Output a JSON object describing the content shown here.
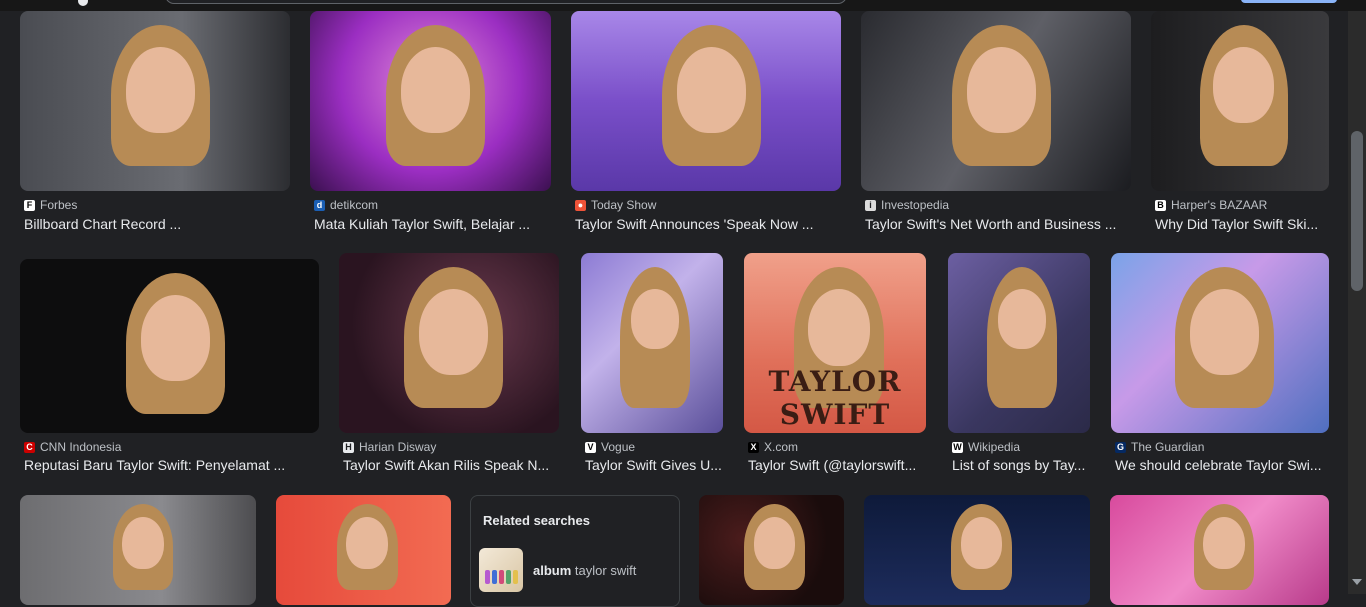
{
  "row1": [
    {
      "source": "Forbes",
      "favicon": "F",
      "favcolor": "#ffffff",
      "favtext": "#000000",
      "title": "Billboard Chart Record ...",
      "bg": "linear-gradient(90deg,#4a4c52,#6a6c72 60%,#2c2d31)"
    },
    {
      "source": "detikcom",
      "favicon": "d",
      "favcolor": "#1a5eb3",
      "favtext": "#ffffff",
      "title": "Mata Kuliah Taylor Swift, Belajar ...",
      "bg": "radial-gradient(circle at 50% 40%,#e28ad8,#9b2ec2 55%,#3b1050)"
    },
    {
      "source": "Today Show",
      "favicon": "●",
      "favcolor": "#ef5338",
      "favtext": "#ffffff",
      "title": "Taylor Swift Announces 'Speak Now ...",
      "bg": "linear-gradient(180deg,#a887e8,#7a4fc9 50%,#5a38a8)"
    },
    {
      "source": "Investopedia",
      "favicon": "i",
      "favcolor": "#dcdcdc",
      "favtext": "#202124",
      "title": "Taylor Swift's Net Worth and Business ...",
      "bg": "linear-gradient(120deg,#2a2b30,#5e5f66 50%,#1b1c20)"
    },
    {
      "source": "Harper's BAZAAR",
      "favicon": "B",
      "favcolor": "#ffffff",
      "favtext": "#000000",
      "title": "Why Did Taylor Swift Ski...",
      "bg": "linear-gradient(90deg,#1d1d1f,#3a3a3d)"
    }
  ],
  "row2": [
    {
      "source": "CNN Indonesia",
      "favicon": "C",
      "favcolor": "#cc0000",
      "favtext": "#ffffff",
      "title": "Reputasi Baru Taylor Swift: Penyelamat ...",
      "bg": "#0d0d0e"
    },
    {
      "source": "Harian Disway",
      "favicon": "H",
      "favcolor": "#e8eaed",
      "favtext": "#202124",
      "title": "Taylor Swift Akan Rilis Speak N...",
      "bg": "radial-gradient(circle at 60% 40%,#6b3a4e,#2a1420 70%)"
    },
    {
      "source": "Vogue",
      "favicon": "V",
      "favcolor": "#ffffff",
      "favtext": "#000000",
      "title": "Taylor Swift Gives U...",
      "bg": "linear-gradient(135deg,#8c7bd4,#c2b2ea 40%,#5a4f9a)"
    },
    {
      "source": "X.com",
      "favicon": "X",
      "favcolor": "#000000",
      "favtext": "#ffffff",
      "title": "Taylor Swift (@taylorswift...",
      "bg": "linear-gradient(180deg,#f0a08a,#e0705a 60%,#d45845)"
    },
    {
      "source": "Wikipedia",
      "favicon": "W",
      "favcolor": "#ffffff",
      "favtext": "#000000",
      "title": "List of songs by Tay...",
      "bg": "linear-gradient(135deg,#6c5fa2,#3a3760 60%,#2b2a48)"
    },
    {
      "source": "The Guardian",
      "favicon": "G",
      "favcolor": "#052962",
      "favtext": "#ffffff",
      "title": "We should celebrate Taylor Swi...",
      "bg": "linear-gradient(135deg,#7aa3e8,#c79ae8 40%,#4f6fc0)"
    }
  ],
  "row2_extra_text": "TAYLOR SWIFT",
  "row3": [
    {
      "bg": "linear-gradient(90deg,#6d6d70,#8a8a8e 60%,#4d4d50)"
    },
    {
      "bg": "linear-gradient(90deg,#e64a3b,#f26b52)"
    },
    {
      "bg": "radial-gradient(circle at 30% 40%,#4b1c1c,#1a0c0c 70%)"
    },
    {
      "bg": "linear-gradient(180deg,#0e1a3a,#1d2c5c)"
    },
    {
      "bg": "linear-gradient(135deg,#d84a9d,#f08ac8 50%,#b83a8a)"
    }
  ],
  "related": {
    "header": "Related searches",
    "suggestion_bold": "album",
    "suggestion_rest": "taylor swift"
  }
}
